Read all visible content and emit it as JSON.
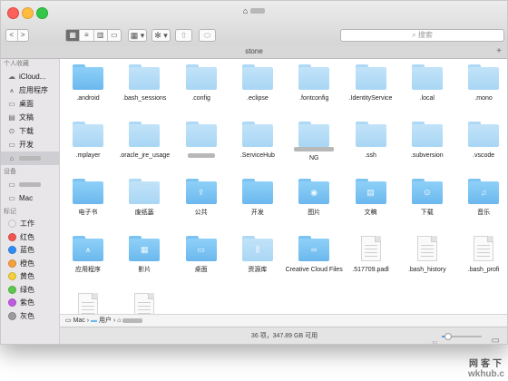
{
  "window": {
    "title_suffix": ""
  },
  "toolbar": {
    "back": "<",
    "forward": ">",
    "view_icons": "▦",
    "view_list": "≡",
    "view_columns": "▥",
    "view_gallery": "▭",
    "arrange": "▦ ▾",
    "action": "✻ ▾",
    "share": "⇧",
    "tags": "⬭",
    "search_placeholder": "搜索"
  },
  "tab": {
    "label": "stone",
    "add": "+"
  },
  "sidebar": {
    "favorites_header": "个人收藏",
    "favorites": [
      {
        "icon": "cloud-icon",
        "glyph": "☁",
        "label": "iCloud..."
      },
      {
        "icon": "applications-icon",
        "glyph": "⩚",
        "label": "应用程序"
      },
      {
        "icon": "desktop-icon",
        "glyph": "▭",
        "label": "桌面"
      },
      {
        "icon": "documents-icon",
        "glyph": "▤",
        "label": "文稿"
      },
      {
        "icon": "downloads-icon",
        "glyph": "⊙",
        "label": "下载"
      },
      {
        "icon": "folder-icon",
        "glyph": "▭",
        "label": "开发"
      },
      {
        "icon": "home-icon",
        "glyph": "⌂",
        "label": ""
      }
    ],
    "devices_header": "设备",
    "devices": [
      {
        "icon": "laptop-icon",
        "glyph": "▭",
        "label": ""
      },
      {
        "icon": "computer-icon",
        "glyph": "▭",
        "label": "Mac"
      }
    ],
    "tags_header": "标记",
    "tags": [
      {
        "label": "工作",
        "color": "#e8e8e8"
      },
      {
        "label": "红色",
        "color": "#f2544f"
      },
      {
        "label": "蓝色",
        "color": "#2f8ef5"
      },
      {
        "label": "橙色",
        "color": "#f7a03a"
      },
      {
        "label": "黄色",
        "color": "#f5d03a"
      },
      {
        "label": "绿色",
        "color": "#5bc84d"
      },
      {
        "label": "紫色",
        "color": "#c05be0"
      },
      {
        "label": "灰色",
        "color": "#9c9c9c"
      }
    ]
  },
  "files": [
    {
      "name": ".android",
      "kind": "folder",
      "style": "norm",
      "glyph": ""
    },
    {
      "name": ".bash_sessions",
      "kind": "folder",
      "style": "light",
      "glyph": ""
    },
    {
      "name": ".config",
      "kind": "folder",
      "style": "light",
      "glyph": ""
    },
    {
      "name": ".eclipse",
      "kind": "folder",
      "style": "light",
      "glyph": ""
    },
    {
      "name": ".fontconfig",
      "kind": "folder",
      "style": "light",
      "glyph": ""
    },
    {
      "name": ".IdentityService",
      "kind": "folder",
      "style": "light",
      "glyph": ""
    },
    {
      "name": ".local",
      "kind": "folder",
      "style": "light",
      "glyph": ""
    },
    {
      "name": ".mono",
      "kind": "folder",
      "style": "light",
      "glyph": ""
    },
    {
      "name": ".mplayer",
      "kind": "folder",
      "style": "light",
      "glyph": ""
    },
    {
      "name": ".oracle_jre_usage",
      "kind": "folder",
      "style": "light",
      "glyph": ""
    },
    {
      "name": "",
      "kind": "folder",
      "style": "light",
      "glyph": ""
    },
    {
      "name": ".ServiceHub",
      "kind": "folder",
      "style": "light",
      "glyph": ""
    },
    {
      "name": "NG",
      "kind": "folder",
      "style": "light",
      "glyph": ""
    },
    {
      "name": ".ssh",
      "kind": "folder",
      "style": "light",
      "glyph": ""
    },
    {
      "name": ".subversion",
      "kind": "folder",
      "style": "light",
      "glyph": ""
    },
    {
      "name": ".vscode",
      "kind": "folder",
      "style": "light",
      "glyph": ""
    },
    {
      "name": "电子书",
      "kind": "folder",
      "style": "norm",
      "glyph": ""
    },
    {
      "name": "废纸篓",
      "kind": "folder",
      "style": "light",
      "glyph": ""
    },
    {
      "name": "公共",
      "kind": "folder",
      "style": "norm",
      "glyph": "⇪"
    },
    {
      "name": "开发",
      "kind": "folder",
      "style": "norm",
      "glyph": ""
    },
    {
      "name": "图片",
      "kind": "folder",
      "style": "norm",
      "glyph": "◉"
    },
    {
      "name": "文稿",
      "kind": "folder",
      "style": "norm",
      "glyph": "▤"
    },
    {
      "name": "下载",
      "kind": "folder",
      "style": "norm",
      "glyph": "⊙"
    },
    {
      "name": "音乐",
      "kind": "folder",
      "style": "norm",
      "glyph": "♫"
    },
    {
      "name": "应用程序",
      "kind": "folder",
      "style": "norm",
      "glyph": "⩚"
    },
    {
      "name": "影片",
      "kind": "folder",
      "style": "norm",
      "glyph": "▦"
    },
    {
      "name": "桌面",
      "kind": "folder",
      "style": "norm",
      "glyph": "▭"
    },
    {
      "name": "资源库",
      "kind": "folder",
      "style": "light",
      "glyph": "⫼"
    },
    {
      "name": "Creative Cloud Files",
      "kind": "folder",
      "style": "norm",
      "glyph": "∞"
    },
    {
      "name": ".517709.padl",
      "kind": "doc",
      "style": "",
      "glyph": ""
    },
    {
      "name": ".bash_history",
      "kind": "doc",
      "style": "",
      "glyph": ""
    },
    {
      "name": ".bash_profi",
      "kind": "doc",
      "style": "",
      "glyph": ""
    },
    {
      "name": "",
      "kind": "doc",
      "style": "",
      "glyph": ""
    },
    {
      "name": "",
      "kind": "doc",
      "style": "",
      "glyph": ""
    }
  ],
  "pathbar": {
    "mac": "Mac",
    "users": "用户"
  },
  "status": {
    "text": "36 项，347.89 GB 可用"
  },
  "icon_zoom": 0.16,
  "watermark": {
    "line1": "网客下",
    "line2": "wkhub.c"
  }
}
